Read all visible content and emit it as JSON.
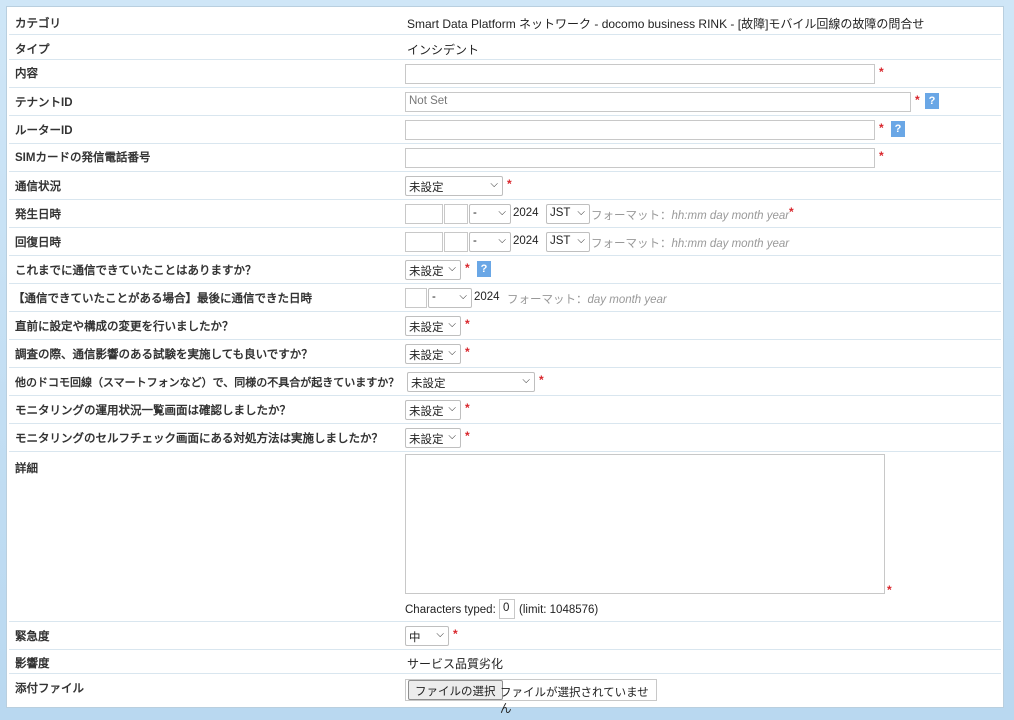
{
  "rows": {
    "category": {
      "label": "カテゴリ",
      "value": "Smart Data Platform ネットワーク - docomo business RINK - [故障]モバイル回線の故障の問合せ"
    },
    "type": {
      "label": "タイプ",
      "value": "インシデント"
    },
    "content": {
      "label": "内容",
      "value": ""
    },
    "tenant": {
      "label": "テナントID",
      "placeholder": "Not Set"
    },
    "router": {
      "label": "ルーターID",
      "value": ""
    },
    "sim_phone": {
      "label": "SIMカードの発信電話番号",
      "value": ""
    },
    "comm_status": {
      "label": "通信状況",
      "selected": "未設定"
    },
    "occurred": {
      "label": "発生日時",
      "month": "-",
      "year": "2024",
      "tz": "JST",
      "format_prefix": "フォーマット：",
      "format": "hh:mm day month year"
    },
    "recovered": {
      "label": "回復日時",
      "month": "-",
      "year": "2024",
      "tz": "JST",
      "format_prefix": "フォーマット：",
      "format": "hh:mm day month year"
    },
    "ever_connected": {
      "label": "これまでに通信できていたことはありますか？",
      "selected": "未設定"
    },
    "last_connected": {
      "label": "【通信できていたことがある場合】最後に通信できた日時",
      "month": "-",
      "year": "2024",
      "format_prefix": "フォーマット：",
      "format": "day month year"
    },
    "config_change": {
      "label": "直前に設定や構成の変更を行いましたか？",
      "selected": "未設定"
    },
    "test_allowed": {
      "label": "調査の際、通信影響のある試験を実施しても良いですか？",
      "selected": "未設定"
    },
    "other_lines": {
      "label": "他のドコモ回線（スマートフォンなど）で、同様の不具合が起きていますか？",
      "selected": "未設定"
    },
    "monitor_list": {
      "label": "モニタリングの運用状況一覧画面は確認しましたか？",
      "selected": "未設定"
    },
    "self_check": {
      "label": "モニタリングのセルフチェック画面にある対処方法は実施しましたか？",
      "selected": "未設定"
    },
    "details": {
      "label": "詳細",
      "chars_label": "Characters typed:",
      "chars_value": "0",
      "limit": "(limit: 1048576)"
    },
    "urgency": {
      "label": "緊急度",
      "selected": "中"
    },
    "impact": {
      "label": "影響度",
      "value": "サービス品質劣化"
    },
    "attachment": {
      "label": "添付ファイル",
      "button": "ファイルの選択",
      "status": "ファイルが選択されていません"
    }
  },
  "required_mark": "*",
  "help_mark": "?",
  "colors": {
    "required": "#d9262c",
    "help": "#6aa7e6",
    "background": "#cfe6f7"
  }
}
